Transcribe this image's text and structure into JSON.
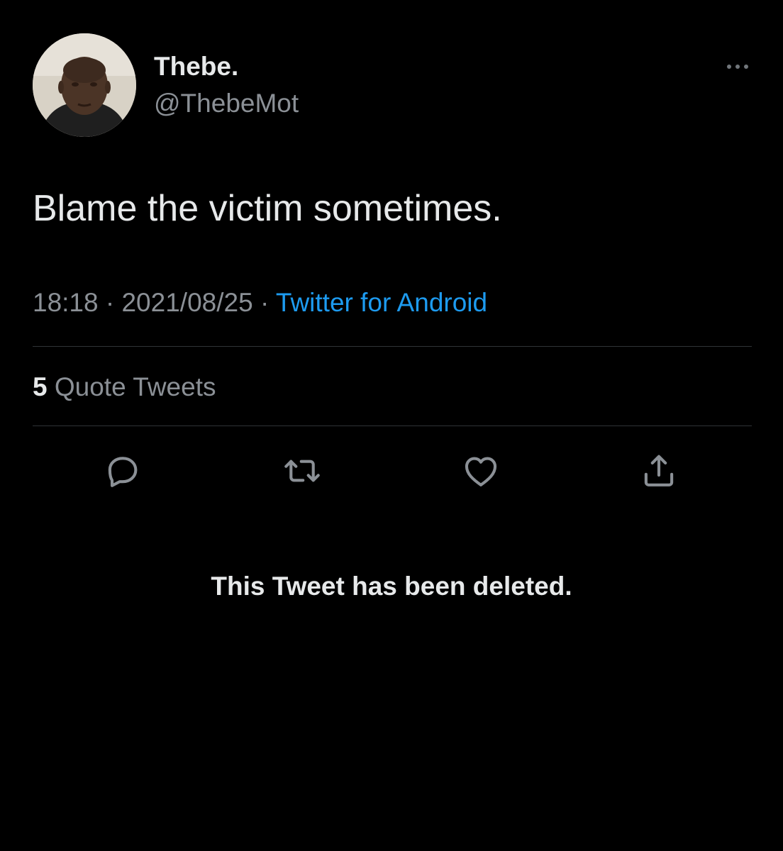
{
  "user": {
    "display_name": "Thebe.",
    "handle": "@ThebeMot",
    "avatar_icon": "profile-photo"
  },
  "tweet": {
    "text": "Blame the victim sometimes.",
    "time": "18:18",
    "separator": "·",
    "date": "2021/08/25",
    "source": "Twitter for Android"
  },
  "stats": {
    "quote_count": "5",
    "quote_label": "Quote Tweets"
  },
  "actions": {
    "reply_icon": "reply-icon",
    "retweet_icon": "retweet-icon",
    "like_icon": "heart-icon",
    "share_icon": "share-icon",
    "more_icon": "more-icon"
  },
  "quoted_tweet": {
    "message": "This Tweet has been deleted."
  },
  "colors": {
    "background": "#000000",
    "text_primary": "#e7e9ea",
    "text_secondary": "#8b9096",
    "accent": "#1d9bf0",
    "divider": "#2f3336"
  }
}
